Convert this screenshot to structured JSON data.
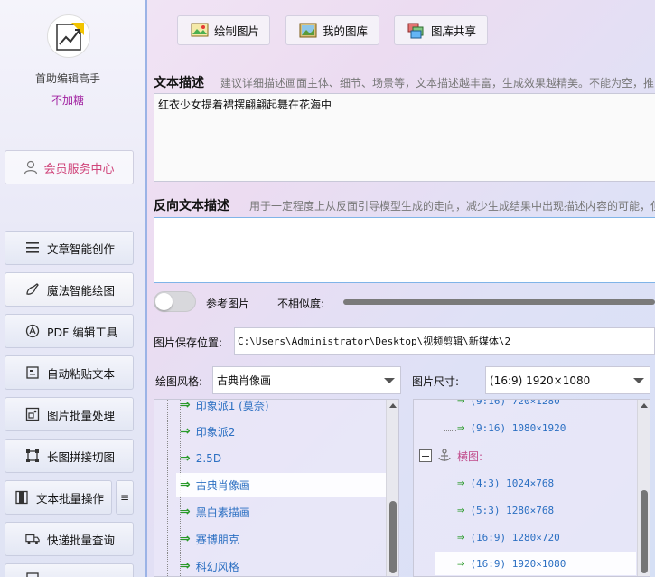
{
  "sidebar": {
    "user_name": "首助编辑高手",
    "user_badge": "不加糖",
    "member_button": "会员服务中心",
    "items": [
      {
        "label": "文章智能创作",
        "icon": "list-icon"
      },
      {
        "label": "魔法智能绘图",
        "icon": "brush-icon"
      },
      {
        "label": "PDF 编辑工具",
        "icon": "pdf-icon"
      },
      {
        "label": "自动粘贴文本",
        "icon": "paste-icon"
      },
      {
        "label": "图片批量处理",
        "icon": "image-icon"
      },
      {
        "label": "长图拼接切图",
        "icon": "crop-icon"
      },
      {
        "label": "文本批量操作",
        "icon": "text-icon"
      },
      {
        "label": "快递批量查询",
        "icon": "truck-icon"
      }
    ],
    "menu_icon": "≡"
  },
  "toolbar": {
    "tabs": [
      {
        "label": "绘制图片",
        "icon": "paint-icon"
      },
      {
        "label": "我的图库",
        "icon": "gallery-icon"
      },
      {
        "label": "图库共享",
        "icon": "share-icon"
      }
    ]
  },
  "prompt": {
    "title": "文本描述",
    "hint": "建议详细描述画面主体、细节、场景等，文本描述越丰富，生成效果越精美。不能为空，推",
    "value": "红衣少女提着裙摆翩翩起舞在花海中"
  },
  "negative": {
    "title": "反向文本描述",
    "hint": "用于一定程度上从反面引导模型生成的走向，减少生成结果中出现描述内容的可能，但",
    "value": ""
  },
  "reference": {
    "toggle_label": "参考图片",
    "similarity_label": "不相似度:",
    "enabled": false
  },
  "save": {
    "label": "图片保存位置:",
    "path": "C:\\Users\\Administrator\\Desktop\\视频剪辑\\新媒体\\2"
  },
  "style": {
    "label": "绘图风格:",
    "selected": "古典肖像画",
    "items": [
      "印象派1 (莫奈)",
      "印象派2",
      "2.5D",
      "古典肖像画",
      "黑白素描画",
      "赛博朋克",
      "科幻风格"
    ],
    "selected_index": 3
  },
  "size": {
    "label": "图片尺寸:",
    "selected": "(16:9) 1920×1080",
    "partial_top": "(9:16) 720×1280",
    "items_top": [
      "(9:16) 1080×1920"
    ],
    "group": "横图:",
    "items": [
      "(4:3) 1024×768",
      "(5:3) 1280×768",
      "(16:9) 1280×720",
      "(16:9) 1920×1080"
    ],
    "selected_index": 3
  },
  "colors": {
    "accent_blue": "#2b6fc2",
    "arrow_green": "#2a9a2a",
    "badge_purple": "#a020a0",
    "member_pink": "#d0457a"
  }
}
